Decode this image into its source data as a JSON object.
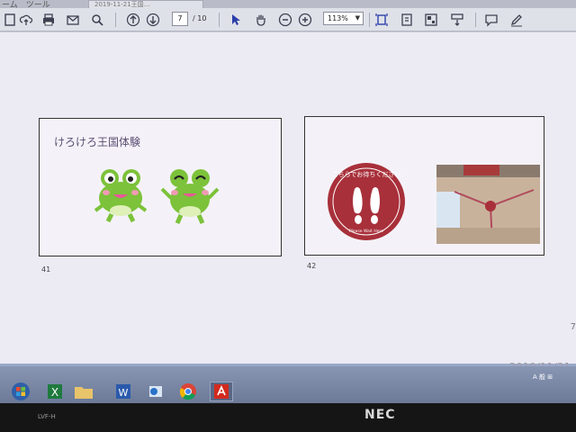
{
  "app": {
    "menu_label": "ーム　ツール",
    "doc_tab_label": "2019-11-21王国..."
  },
  "toolbar": {
    "page_current": "7",
    "page_total": "/ 10",
    "zoom_value": "113%"
  },
  "slides": [
    {
      "title": "けろけろ王国体験",
      "page_number": "41",
      "images": [
        "frog-illustration",
        "frog-illustration"
      ]
    },
    {
      "title": "",
      "page_number": "42",
      "sticker_text_jp": "こちらでお待ちください",
      "sticker_text_en": "Please Wait Here",
      "images": [
        "wait-here-sticker",
        "floor-sticker-photo"
      ]
    }
  ],
  "viewer": {
    "next_page_hint": "7",
    "date_stamp": "2019/11/21"
  },
  "taskbar": {
    "items": [
      "start-button",
      "excel-icon",
      "file-explorer-icon",
      "word-icon",
      "outlook-icon",
      "chrome-icon",
      "acrobat-icon"
    ],
    "tray_text": "A 般 ⊞"
  },
  "device": {
    "brand": "NEC",
    "model_label": "LVF-H"
  },
  "colors": {
    "sticker_red": "#a8303a",
    "frog_green": "#7cc23a",
    "toolbar_bg": "#dfe1e9",
    "content_bg": "#eceaf3"
  }
}
